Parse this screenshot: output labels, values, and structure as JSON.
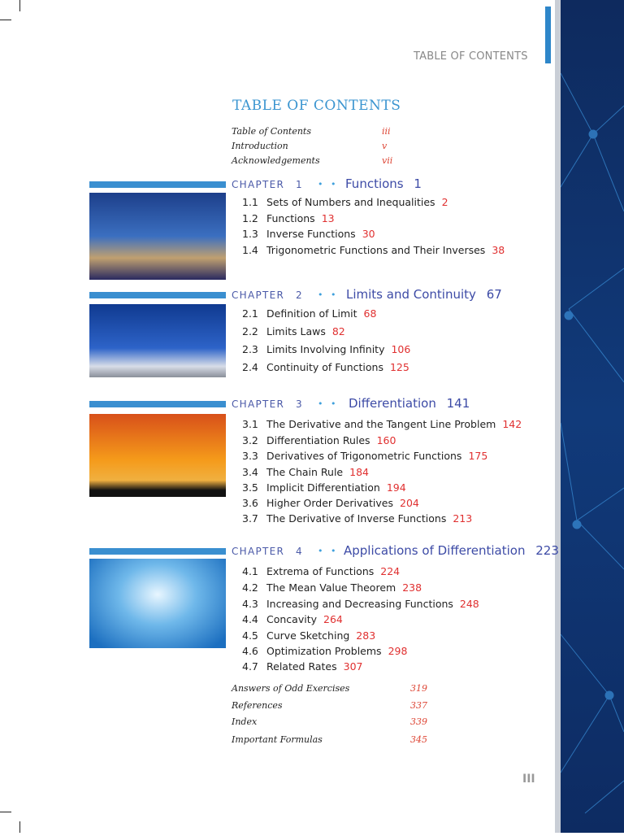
{
  "running_header": "TABLE OF CONTENTS",
  "title": "TABLE OF CONTENTS",
  "front_matter": [
    {
      "label": "Table of Contents",
      "page": "iii"
    },
    {
      "label": "Introduction",
      "page": "v"
    },
    {
      "label": "Acknowledgements",
      "page": "vii"
    }
  ],
  "chapters": [
    {
      "label": "CHAPTER",
      "number": "1",
      "dots": "• •",
      "title": "Functions",
      "page": "1",
      "image": "london-eye-photo",
      "sections": [
        [
          "1.1",
          "Sets of Numbers and Inequalities",
          "2"
        ],
        [
          "1.2",
          "Functions",
          "13"
        ],
        [
          "1.3",
          "Inverse Functions",
          "30"
        ],
        [
          "1.4",
          "Trigonometric Functions and Their Inverses",
          "38"
        ]
      ]
    },
    {
      "label": "CHAPTER",
      "number": "2",
      "dots": "• •",
      "title": "Limits and Continuity",
      "page": "67",
      "image": "rocket-launch-photo",
      "sections": [
        [
          "2.1",
          "Definition of Limit",
          "68"
        ],
        [
          "2.2",
          "Limits Laws",
          "82"
        ],
        [
          "2.3",
          "Limits Involving Infinity",
          "106"
        ],
        [
          "2.4",
          "Continuity of Functions",
          "125"
        ]
      ]
    },
    {
      "label": "CHAPTER",
      "number": "3",
      "dots": "• •",
      "title": "Differentiation",
      "page": "141",
      "image": "airplane-sunset-photo",
      "sections": [
        [
          "3.1",
          "The Derivative and the Tangent Line Problem",
          "142"
        ],
        [
          "3.2",
          "Differentiation Rules",
          "160"
        ],
        [
          "3.3",
          "Derivatives of Trigonometric Functions",
          "175"
        ],
        [
          "3.4",
          "The Chain Rule",
          "184"
        ],
        [
          "3.5",
          "Implicit Differentiation",
          "194"
        ],
        [
          "3.6",
          "Higher Order Derivatives",
          "204"
        ],
        [
          "3.7",
          "The Derivative of Inverse Functions",
          "213"
        ]
      ]
    },
    {
      "label": "CHAPTER",
      "number": "4",
      "dots": "• •",
      "title": "Applications of Differentiation",
      "page": "223",
      "image": "water-ripple-photo",
      "sections": [
        [
          "4.1",
          "Extrema of Functions",
          "224"
        ],
        [
          "4.2",
          "The Mean Value Theorem",
          "238"
        ],
        [
          "4.3",
          "Increasing and Decreasing Functions",
          "248"
        ],
        [
          "4.4",
          "Concavity",
          "264"
        ],
        [
          "4.5",
          "Curve Sketching",
          "283"
        ],
        [
          "4.6",
          "Optimization Problems",
          "298"
        ],
        [
          "4.7",
          "Related Rates",
          "307"
        ]
      ]
    }
  ],
  "back_matter": [
    {
      "label": "Answers of Odd Exercises",
      "page": "319"
    },
    {
      "label": "References",
      "page": "337"
    },
    {
      "label": "Index",
      "page": "339"
    },
    {
      "label": "Important Formulas",
      "page": "345"
    }
  ],
  "page_number": "III"
}
